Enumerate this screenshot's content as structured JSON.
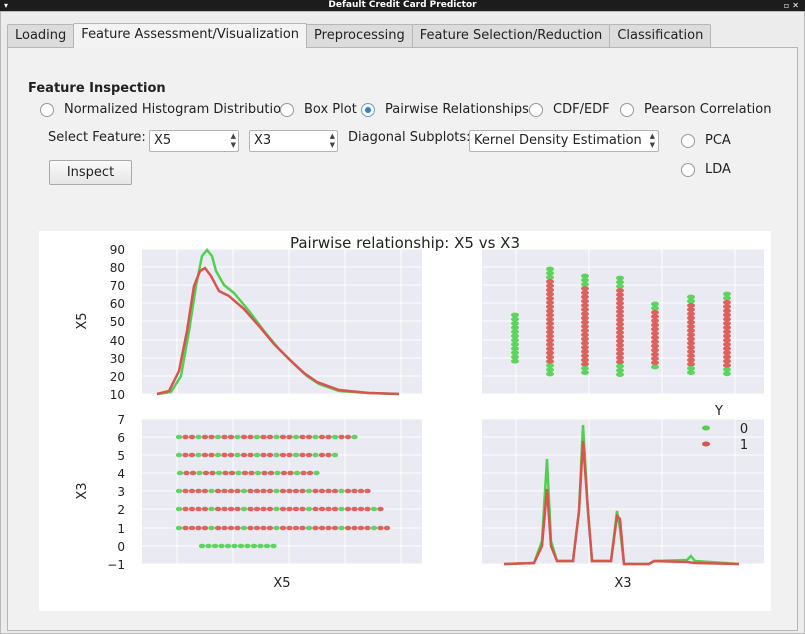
{
  "window": {
    "title": "Default Credit Card Predictor"
  },
  "tabs": [
    "Loading",
    "Feature Assessment/Visualization",
    "Preprocessing",
    "Feature Selection/Reduction",
    "Classification"
  ],
  "inspection": {
    "title": "Feature Inspection",
    "options": [
      "Normalized Histogram Distribution",
      "Box Plot",
      "Pairwise Relationships",
      "CDF/EDF",
      "Pearson Correlation"
    ],
    "selected_option": "Pairwise Relationships",
    "select_feature_label": "Select Feature:",
    "feature1": "X5",
    "feature2": "X3",
    "diag_label": "Diagonal Subplots:",
    "diag_value": "Kernel Density Estimation",
    "extra_options": [
      "PCA",
      "LDA"
    ],
    "inspect_button": "Inspect"
  },
  "chart_data": {
    "type": "scatter",
    "title": "Pairwise relationship: X5 vs X3",
    "xlabels": [
      "X5",
      "X3"
    ],
    "ylabels": [
      "X5",
      "X3"
    ],
    "x5_ticks": [
      "90",
      "80",
      "70",
      "60",
      "50",
      "40",
      "30",
      "20",
      "10"
    ],
    "x3_ticks": [
      "7",
      "6",
      "5",
      "4",
      "3",
      "2",
      "1",
      "0",
      "−1"
    ],
    "legend": {
      "title": "Y",
      "entries": [
        "0",
        "1"
      ]
    },
    "colors": {
      "class0": "#4fd04f",
      "class1": "#d9534f",
      "grid_bg": "#eaeaf2"
    }
  }
}
